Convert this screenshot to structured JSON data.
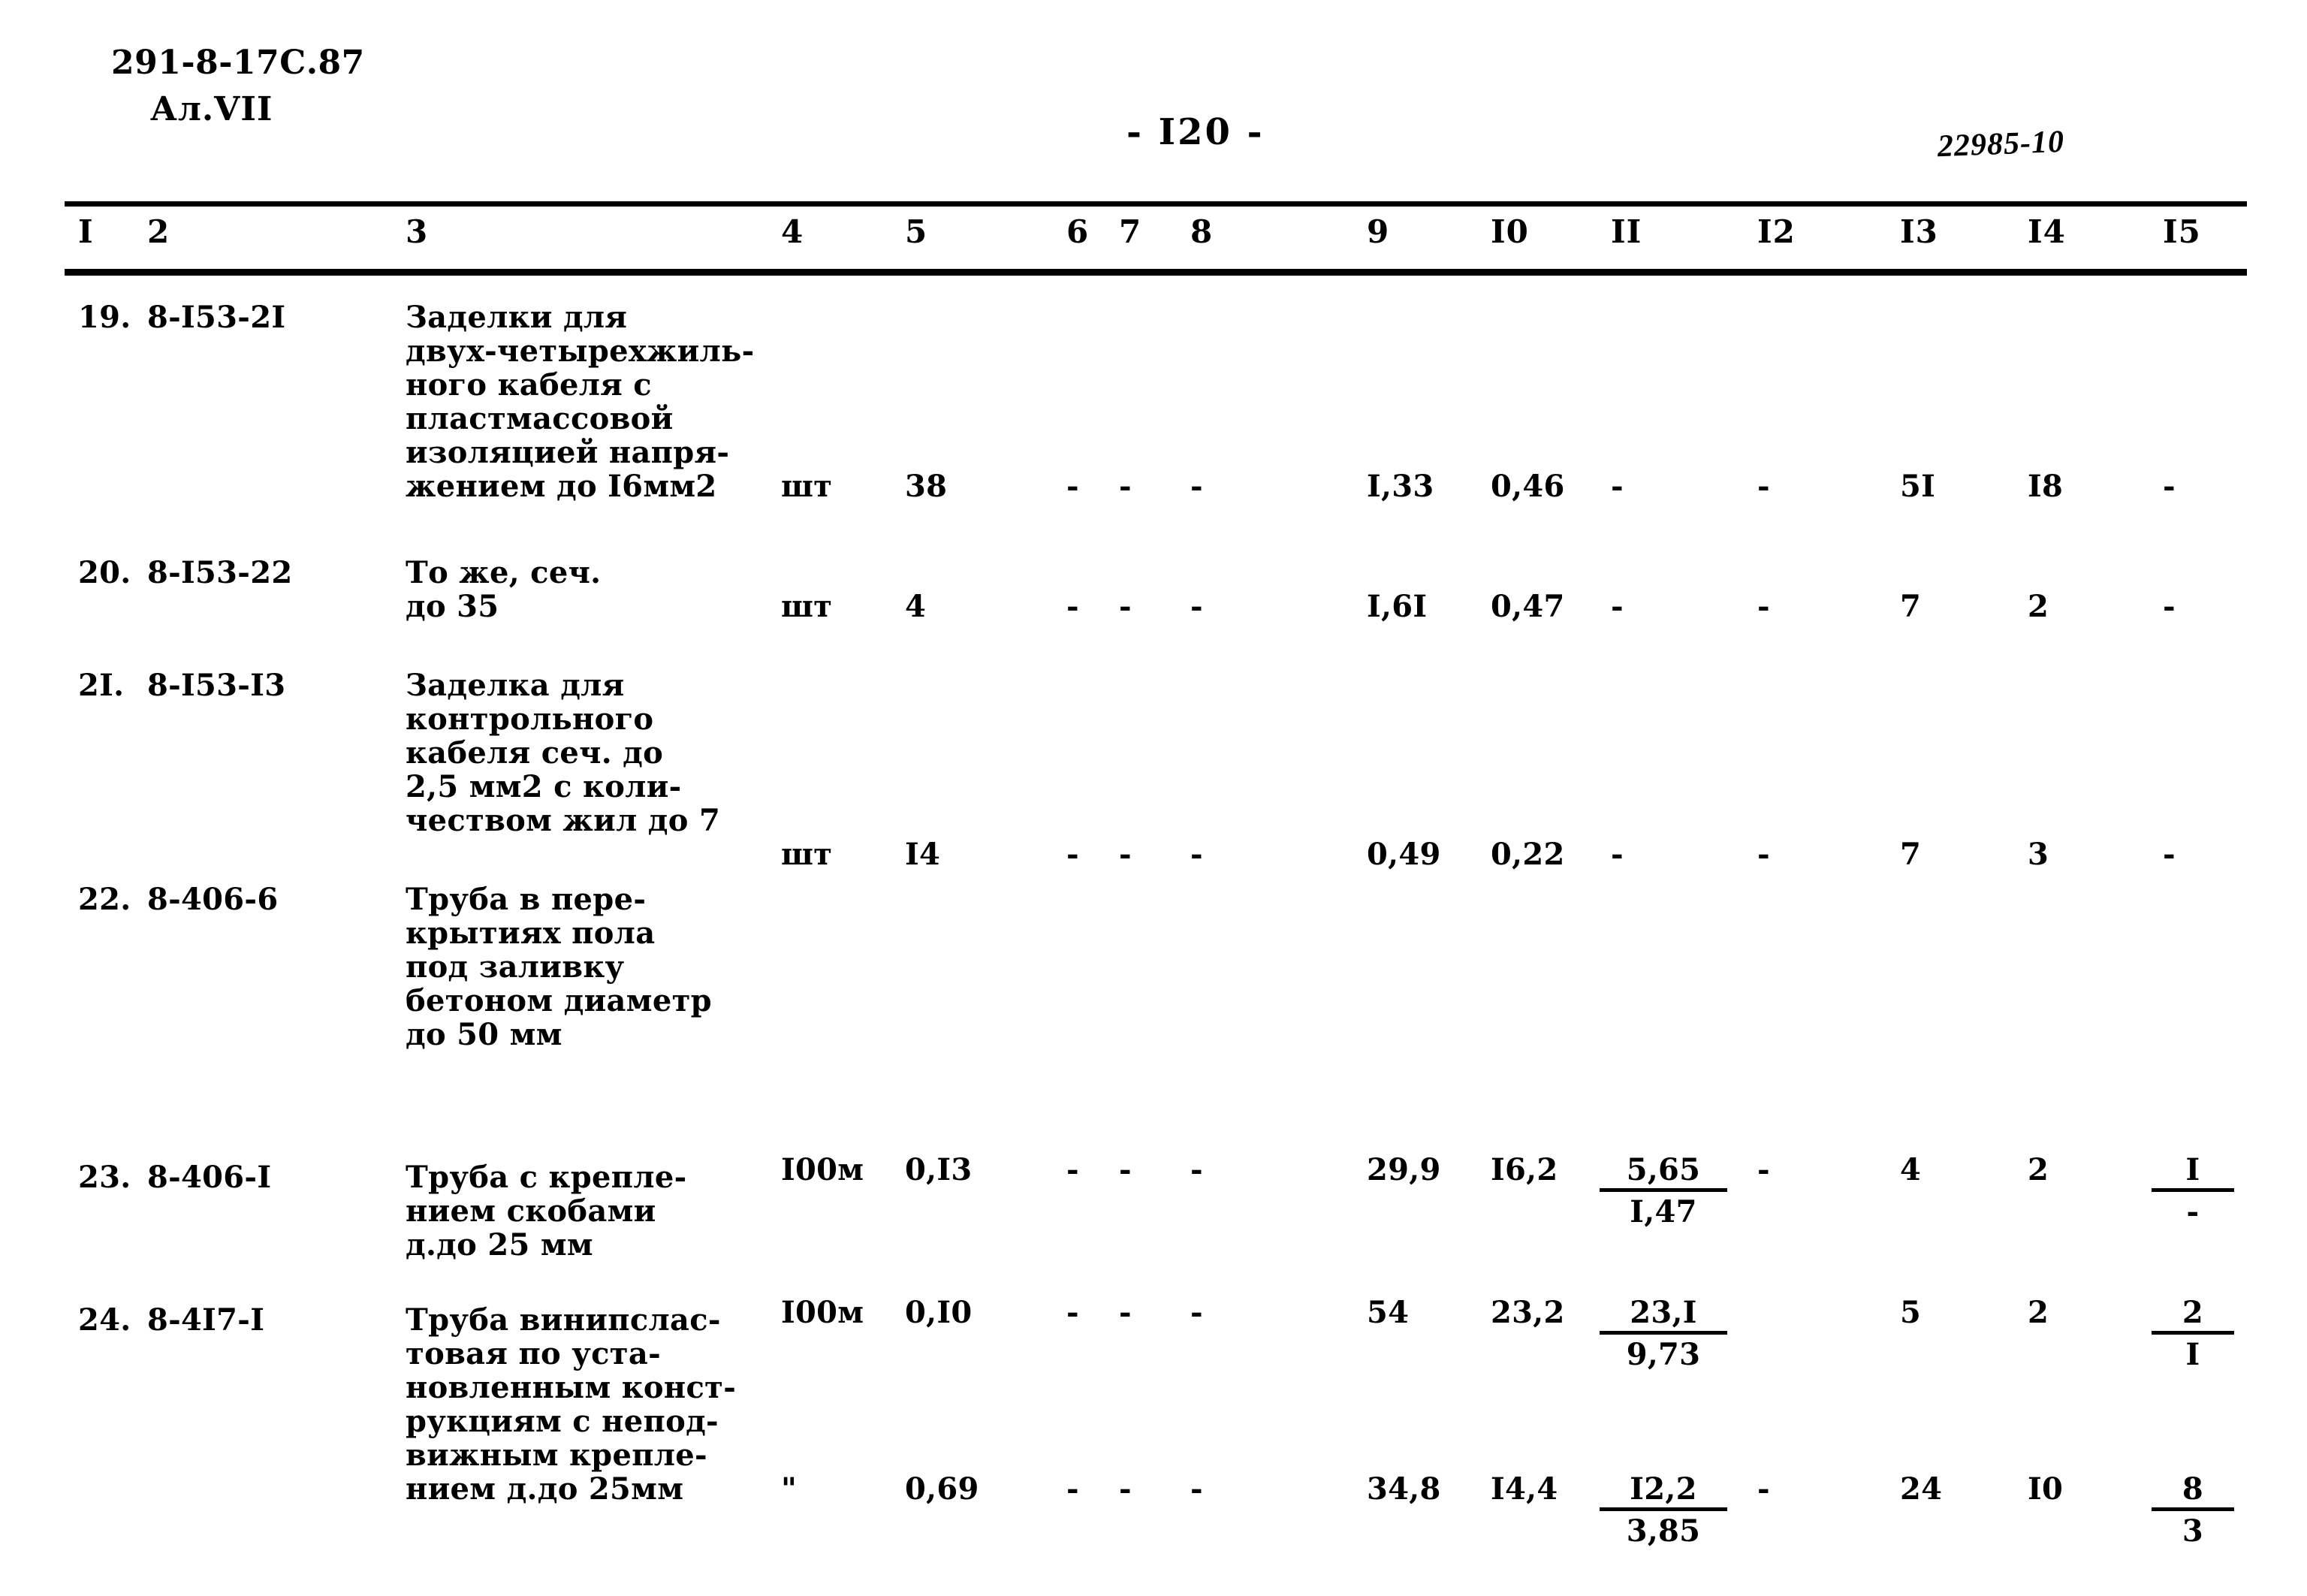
{
  "header": {
    "doc_code": "291-8-17С.87",
    "album": "Ал.VII",
    "page_number": "- I20 -",
    "stamp_number": "22985-10"
  },
  "table": {
    "column_headers": [
      "I",
      "2",
      "3",
      "4",
      "5",
      "6",
      "7",
      "8",
      "9",
      "I0",
      "II",
      "I2",
      "I3",
      "I4",
      "I5"
    ],
    "rows": [
      {
        "num": "19.",
        "code": "8-I53-2I",
        "desc": "Заделки для\nдвух-четырехжиль-\nного кабеля с\nпластмассовой\nизоляцией напря-\nжением до I6мм2",
        "unit": "шт",
        "qty": "38",
        "c6": "-",
        "c7": "-",
        "c8": "-",
        "c9": "I,33",
        "c10": "0,46",
        "c11": "-",
        "c11_top": "",
        "c11_bot": "",
        "c12": "-",
        "c13": "5I",
        "c14": "I8",
        "c15": "-",
        "c15_top": "",
        "c15_bot": ""
      },
      {
        "num": "20.",
        "code": "8-I53-22",
        "desc": "То же, сеч.\nдо 35",
        "unit": "шт",
        "qty": "4",
        "c6": "-",
        "c7": "-",
        "c8": "-",
        "c9": "I,6I",
        "c10": "0,47",
        "c11": "-",
        "c11_top": "",
        "c11_bot": "",
        "c12": "-",
        "c13": "7",
        "c14": "2",
        "c15": "-",
        "c15_top": "",
        "c15_bot": ""
      },
      {
        "num": "2I.",
        "code": "8-I53-I3",
        "desc": "Заделка для\nконтрольного\nкабеля сеч. до\n2,5 мм2 с коли-\nчеством жил до 7",
        "unit": "шт",
        "qty": "I4",
        "c6": "-",
        "c7": "-",
        "c8": "-",
        "c9": "0,49",
        "c10": "0,22",
        "c11": "-",
        "c11_top": "",
        "c11_bot": "",
        "c12": "-",
        "c13": "7",
        "c14": "3",
        "c15": "-",
        "c15_top": "",
        "c15_bot": ""
      },
      {
        "num": "22.",
        "code": "8-406-6",
        "desc": "Труба в пере-\nкрытиях пола\nпод заливку\nбетоном диаметр\nдо 50 мм",
        "unit": "I00м",
        "qty": "0,I3",
        "c6": "-",
        "c7": "-",
        "c8": "-",
        "c9": "29,9",
        "c10": "I6,2",
        "c11": "",
        "c11_top": "5,65",
        "c11_bot": "I,47",
        "c12": "-",
        "c13": "4",
        "c14": "2",
        "c15": "",
        "c15_top": "I",
        "c15_bot": "-"
      },
      {
        "num": "23.",
        "code": "8-406-I",
        "desc": "Труба с крепле-\nнием скобами\nд.до 25 мм",
        "unit": "I00м",
        "qty": "0,I0",
        "c6": "-",
        "c7": "-",
        "c8": "-",
        "c9": "54",
        "c10": "23,2",
        "c11": "",
        "c11_top": "23,I",
        "c11_bot": "9,73",
        "c12": "",
        "c13": "5",
        "c14": "2",
        "c15": "",
        "c15_top": "2",
        "c15_bot": "I"
      },
      {
        "num": "24.",
        "code": "8-4I7-I",
        "desc": "Труба винипслас-\nтовая по уста-\nновленным конст-\nрукциям с непод-\nвижным крепле-\nнием д.до 25мм",
        "unit": "\"",
        "qty": "0,69",
        "c6": "-",
        "c7": "-",
        "c8": "-",
        "c9": "34,8",
        "c10": "I4,4",
        "c11": "",
        "c11_top": "I2,2",
        "c11_bot": "3,85",
        "c12": "-",
        "c13": "24",
        "c14": "I0",
        "c15": "",
        "c15_top": "8",
        "c15_bot": "3"
      }
    ]
  }
}
